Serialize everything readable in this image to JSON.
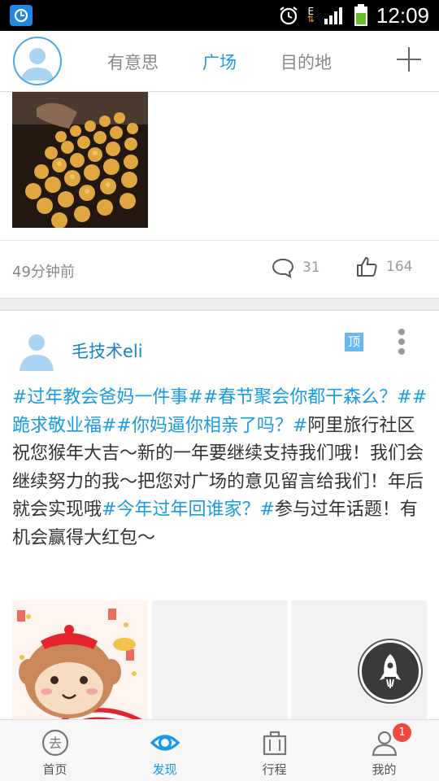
{
  "status_bar": {
    "time": "12:09",
    "network_label": "E",
    "icons": [
      "app-sync-icon",
      "alarm-icon",
      "signal-icon",
      "battery-icon"
    ]
  },
  "top_nav": {
    "tabs": [
      {
        "label": "有意思",
        "active": false
      },
      {
        "label": "广场",
        "active": true
      },
      {
        "label": "目的地",
        "active": false
      }
    ],
    "add_icon": "plus-icon"
  },
  "card1": {
    "time_ago": "49分钟前",
    "comment_count": "31",
    "like_count": "164"
  },
  "card2": {
    "username": "毛技术eli",
    "top_badge": "顶",
    "segments": [
      {
        "text": "#过年教会爸妈一件事##春节聚会你都干森么？##跪求敬业福##你妈逼你相亲了吗？#",
        "tag": true
      },
      {
        "text": "阿里旅行社区祝您猴年大吉～新的一年要继续支持我们哦！我们会继续努力的我～把您对广场的意见留言给我们！年后就会实现哦",
        "tag": false
      },
      {
        "text": "#今年过年回谁家？#",
        "tag": true
      },
      {
        "text": "参与过年话题！有机会赢得大红包～",
        "tag": false
      }
    ]
  },
  "bottom_nav": {
    "items": [
      {
        "label": "首页",
        "icon": "home-go-icon",
        "active": false
      },
      {
        "label": "发现",
        "icon": "eye-icon",
        "active": true
      },
      {
        "label": "行程",
        "icon": "suitcase-icon",
        "active": false
      },
      {
        "label": "我的",
        "icon": "user-icon",
        "active": false
      }
    ],
    "profile_badge": "1"
  },
  "colors": {
    "accent": "#1a9be6",
    "badge_red": "#f04a3e",
    "username_blue": "#1a7fc4"
  }
}
